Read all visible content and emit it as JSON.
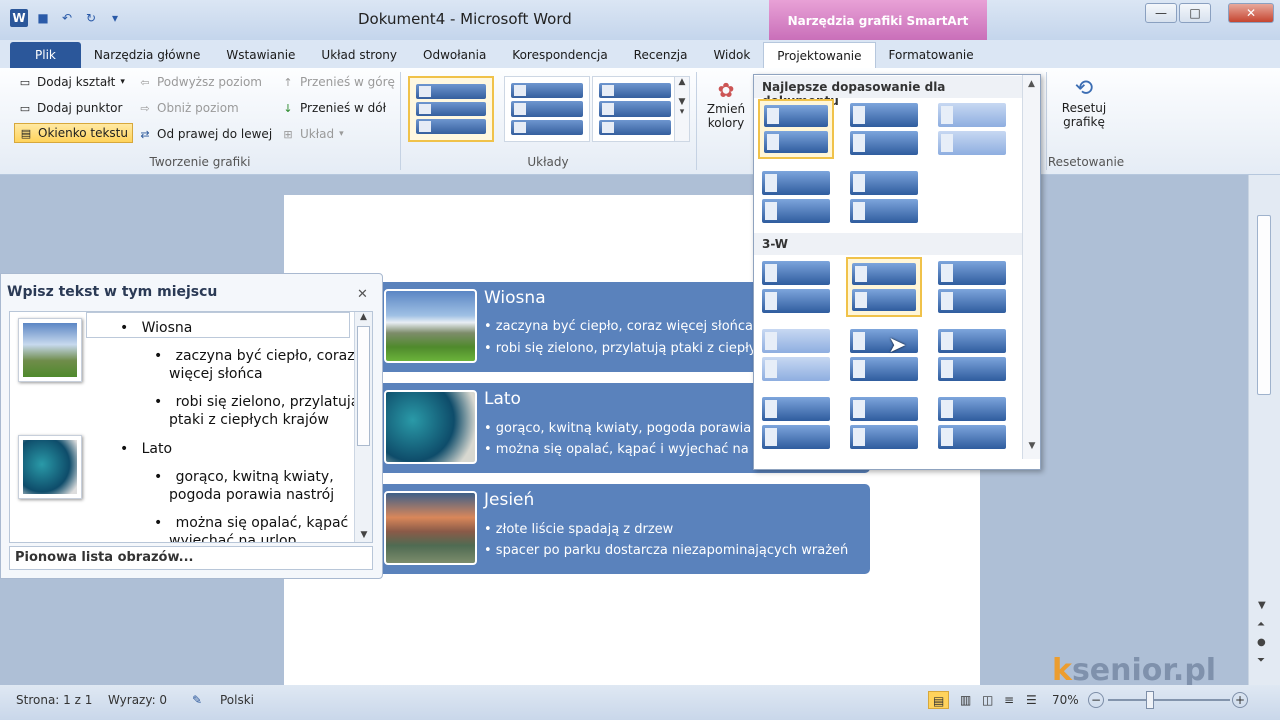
{
  "window": {
    "title": "Dokument4 - Microsoft Word",
    "context_tab": "Narzędzia grafiki SmartArt"
  },
  "qat": {
    "icons": [
      "word-icon",
      "save-icon",
      "undo-icon",
      "redo-icon",
      "customize-icon"
    ]
  },
  "tabs": [
    "Plik",
    "Narzędzia główne",
    "Wstawianie",
    "Układ strony",
    "Odwołania",
    "Korespondencja",
    "Recenzja",
    "Widok",
    "Projektowanie",
    "Formatowanie"
  ],
  "ribbon": {
    "create": {
      "add_shape": "Dodaj kształt",
      "add_bullet": "Dodaj punktor",
      "text_pane": "Okienko tekstu",
      "promote": "Podwyższ poziom",
      "demote": "Obniż poziom",
      "rtl": "Od prawej do lewej",
      "move_up": "Przenieś w górę",
      "move_down": "Przenieś w dół",
      "layout": "Układ",
      "group_label": "Tworzenie grafiki"
    },
    "layouts_label": "Układy",
    "change_colors_line1": "Zmień",
    "change_colors_line2": "kolory",
    "reset_line1": "Resetuj",
    "reset_line2": "grafikę",
    "reset_group": "Resetowanie"
  },
  "gallery": {
    "section1": "Najlepsze dopasowanie dla dokumentu",
    "section2": "3-W"
  },
  "smartart": {
    "items": [
      {
        "title": "Wiosna",
        "bullets": [
          "• zaczyna być ciepło, coraz więcej słońca",
          "• robi się zielono, przylatują ptaki z ciepły"
        ]
      },
      {
        "title": "Lato",
        "bullets": [
          "• gorąco, kwitną kwiaty, pogoda porawia",
          "• można się opalać, kąpać i wyjechać na u"
        ]
      },
      {
        "title": "Jesień",
        "bullets": [
          "• złote liście spadają z drzew",
          "• spacer po parku dostarcza niezapominających wrażeń"
        ]
      }
    ]
  },
  "textpane": {
    "title": "Wpisz tekst w tym miejscu",
    "lines": [
      "Wiosna",
      "zaczyna być ciepło, coraz",
      "więcej słońca",
      "robi się zielono, przylatują",
      "ptaki z ciepłych krajów",
      "Lato",
      "gorąco, kwitną kwiaty,",
      "pogoda porawia nastrój",
      "można się opalać, kąpać i",
      "wyjechać na urlop"
    ],
    "footer": "Pionowa lista obrazów..."
  },
  "status": {
    "page": "Strona: 1 z 1",
    "words": "Wyrazy: 0",
    "lang": "Polski",
    "zoom": "70%"
  },
  "watermark": "senior.pl",
  "colors": {
    "accent": "#2b579a",
    "smartart_fill": "#5a82bc",
    "context": "#c96fb9"
  }
}
